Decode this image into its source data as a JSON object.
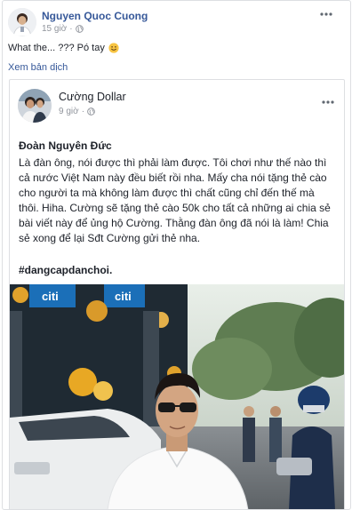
{
  "outer_post": {
    "author": "Nguyen Quoc Cuong",
    "time": "15 giờ",
    "dot": "·",
    "text": "What the... ??? Pó tay",
    "translate_link": "Xem bản dịch",
    "privacy_icon": "globe-icon",
    "emoji_icon": "smile-emoji-icon",
    "more_icon": "more-options-icon"
  },
  "shared_post": {
    "author": "Cường Dollar",
    "time": "9 giờ",
    "dot": "·",
    "title": "Đoàn Nguyên Đức",
    "body": "Là đàn ông, nói được thì phải làm được. Tôi chơi như thế nào thì cả nước Việt Nam này đều biết rồi nha. Mấy cha nói tặng thẻ cào cho người ta mà không làm được thì chất cũng chỉ đến thế mà thôi. Hiha. Cường sẽ tặng thẻ cào 50k cho tất cả những ai chia sẻ bài viết này để ủng hộ Cường. Thằng đàn ông đã nói là làm! Chia sẻ xong để lại Sđt Cường gửi thẻ nha.",
    "hashtag": "#dangcapdanchoi.",
    "privacy_icon": "globe-icon",
    "more_icon": "more-options-icon",
    "photo_sign_text": "citi"
  },
  "colors": {
    "link_blue": "#365899",
    "meta_gray": "#90949c",
    "text": "#1d2129",
    "border": "#dddfe2"
  }
}
